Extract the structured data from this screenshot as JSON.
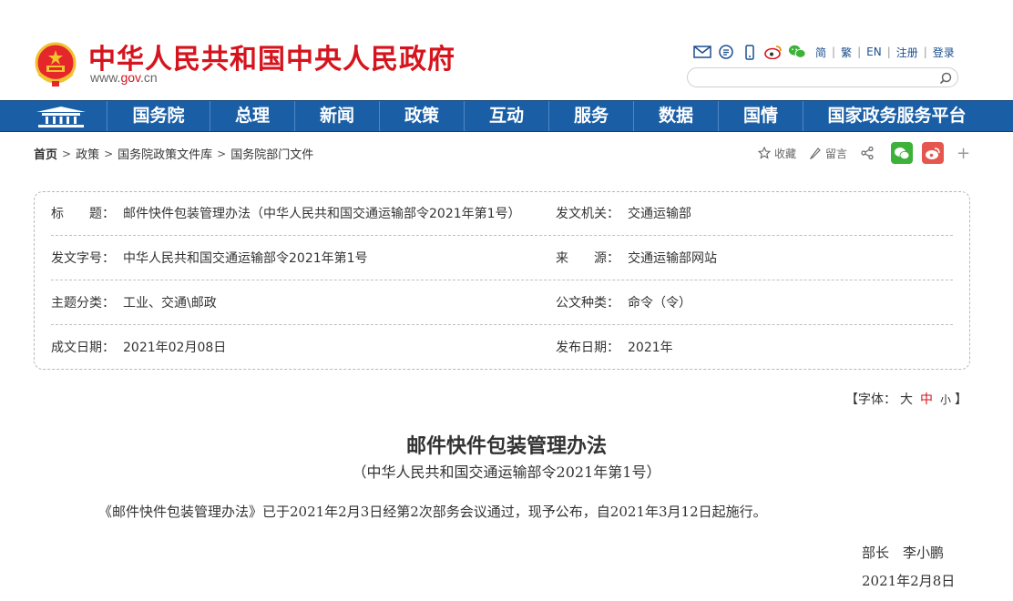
{
  "header": {
    "site_title": "中华人民共和国中央人民政府",
    "url_prefix": "www.",
    "url_highlight": "gov",
    "url_suffix": ".cn",
    "lang_links": [
      "简",
      "繁",
      "EN",
      "注册",
      "登录"
    ],
    "lang_separator": "|",
    "search_placeholder": "",
    "icons": [
      "mail-icon",
      "rss-icon",
      "mobile-icon",
      "weibo-icon",
      "wechat-icon",
      "search-icon"
    ]
  },
  "nav": {
    "items": [
      "国务院",
      "总理",
      "新闻",
      "政策",
      "互动",
      "服务",
      "数据",
      "国情",
      "国家政务服务平台"
    ]
  },
  "breadcrumb": {
    "items": [
      "首页",
      "政策",
      "国务院政策文件库",
      "国务院部门文件"
    ],
    "separator": ">"
  },
  "share": {
    "favorite_label": "收藏",
    "comment_label": "留言",
    "more": "+"
  },
  "info": {
    "rows": [
      {
        "label1": "标　　题：",
        "value1": "邮件快件包装管理办法（中华人民共和国交通运输部令2021年第1号）",
        "label2": "发文机关：",
        "value2": "交通运输部"
      },
      {
        "label1": "发文字号：",
        "value1": "中华人民共和国交通运输部令2021年第1号",
        "label2": "来　　源：",
        "value2": "交通运输部网站"
      },
      {
        "label1": "主题分类：",
        "value1": "工业、交通\\邮政",
        "label2": "公文种类：",
        "value2": "命令（令）"
      },
      {
        "label1": "成文日期：",
        "value1": "2021年02月08日",
        "label2": "发布日期：",
        "value2": "2021年"
      }
    ]
  },
  "font_size": {
    "prefix": "【字体：",
    "large": "大",
    "medium": "中",
    "small": "小",
    "suffix": "】",
    "selected": "中"
  },
  "article": {
    "title": "邮件快件包装管理办法",
    "subtitle": "（中华人民共和国交通运输部令2021年第1号）",
    "body": "《邮件快件包装管理办法》已于2021年2月3日经第2次部务会议通过，现予公布，自2021年3月12日起施行。",
    "signature": "部长　李小鹏",
    "date": "2021年2月8日"
  },
  "colors": {
    "brand_red": "#d6141d",
    "nav_blue": "#1a5fa6",
    "link_blue": "#1c4e8e"
  }
}
